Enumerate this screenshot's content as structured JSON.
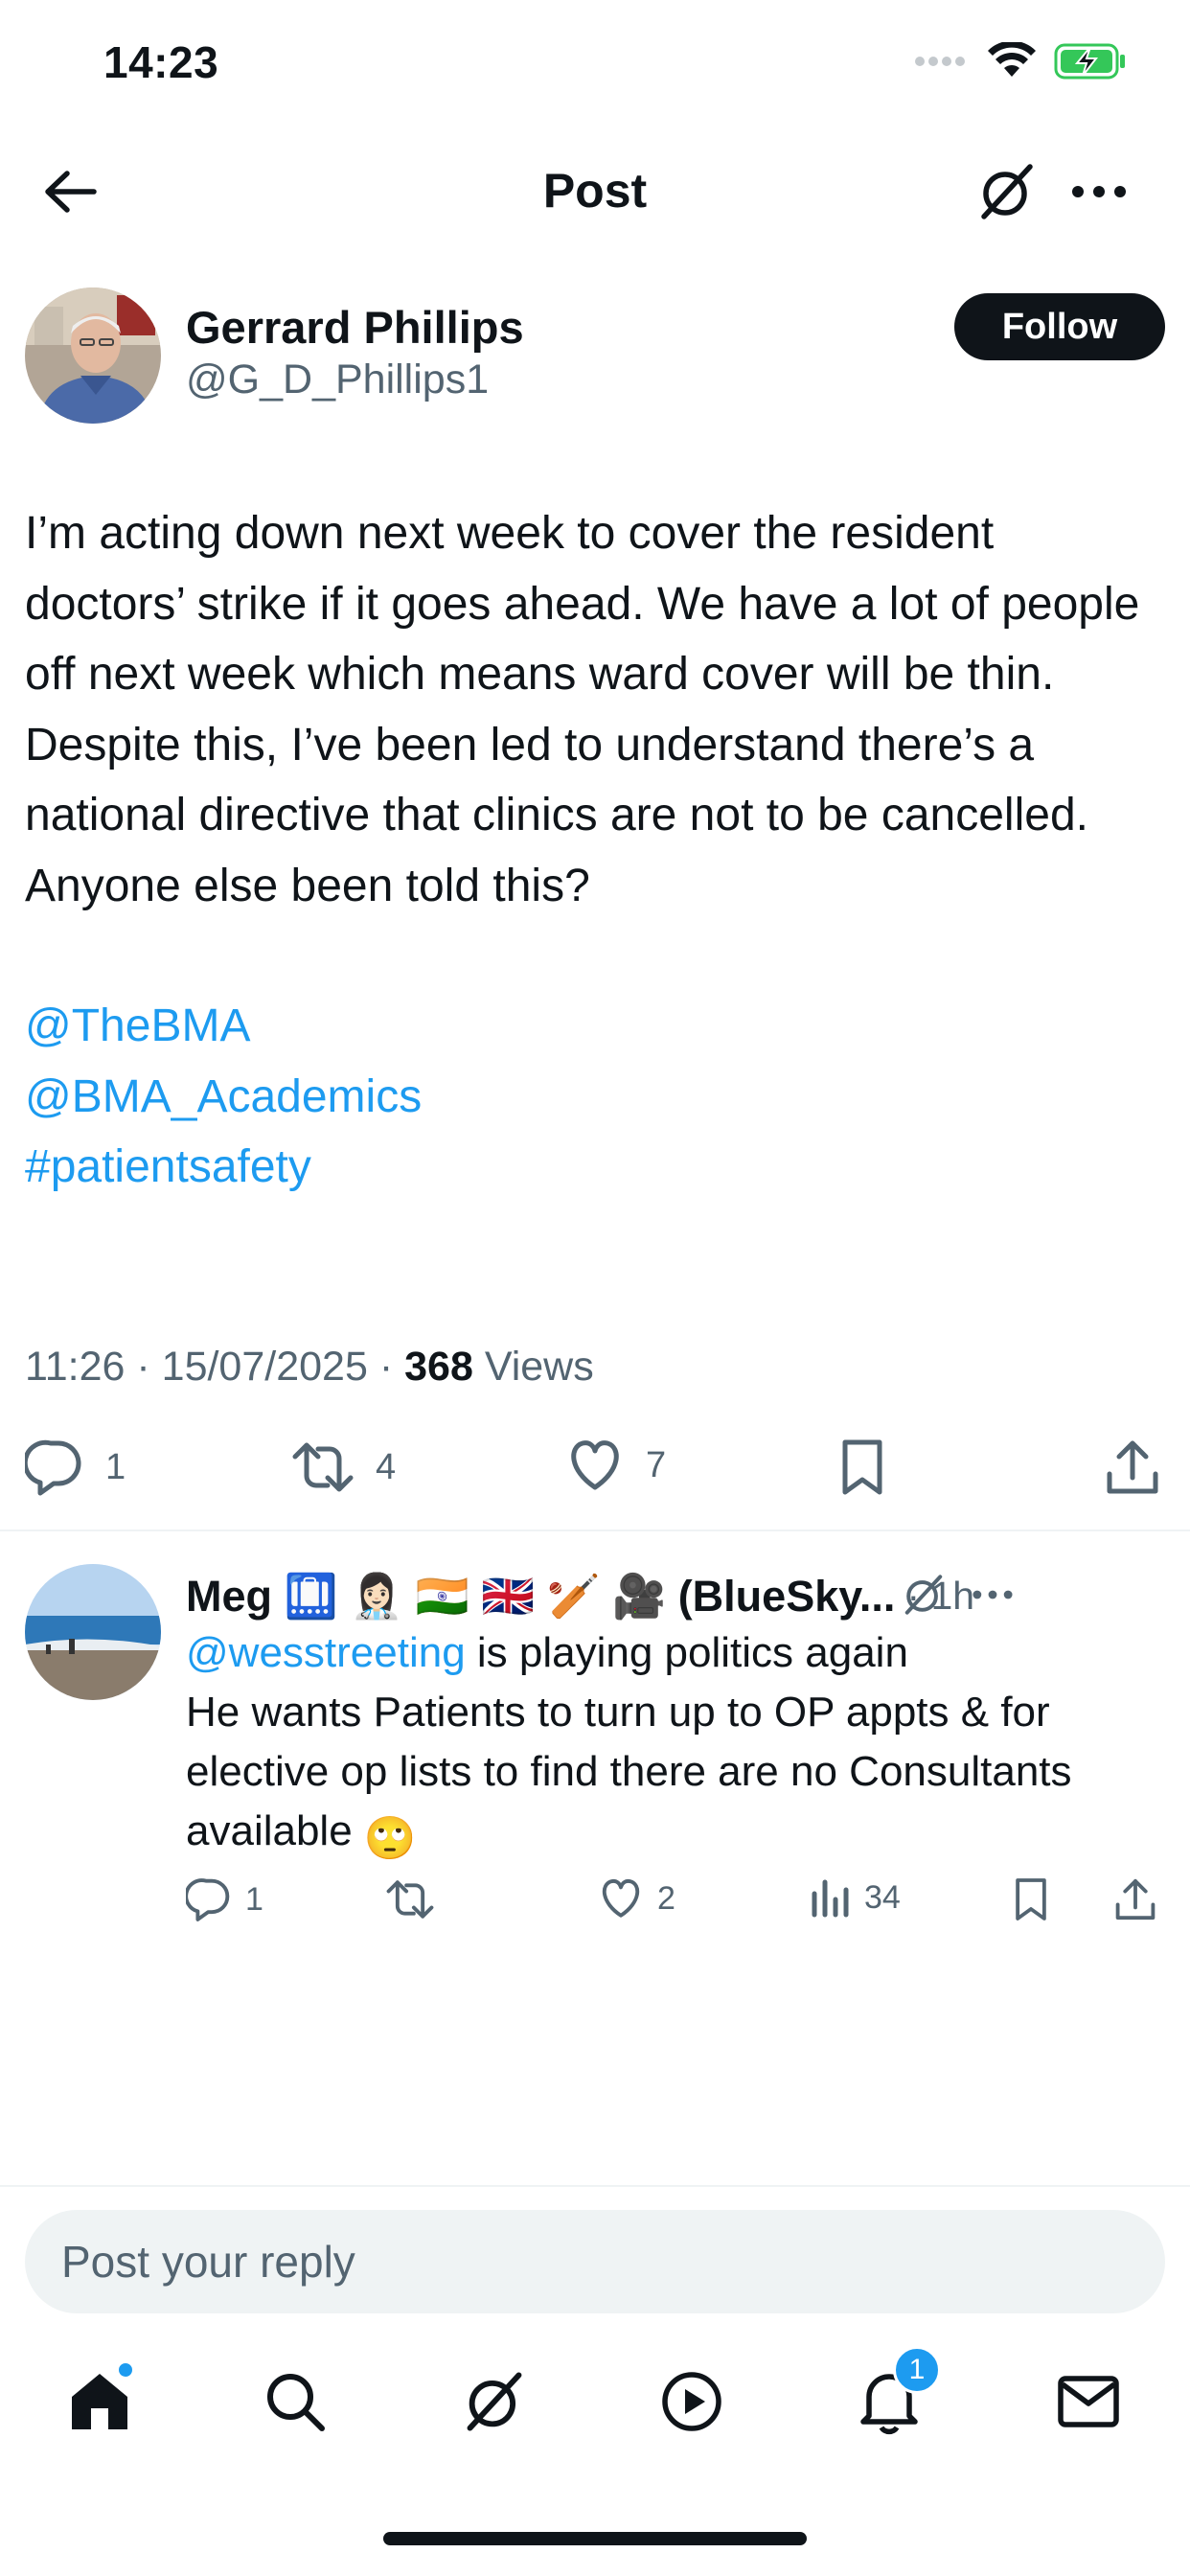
{
  "status_bar": {
    "time": "14:23",
    "signal_icon": "signal-dots-icon",
    "wifi_icon": "wifi-icon",
    "battery_icon": "battery-charging-icon",
    "battery_color": "#34c759"
  },
  "header": {
    "title": "Post",
    "back_icon": "back-arrow-icon",
    "grok_icon": "grok-icon",
    "more_icon": "more-icon"
  },
  "post": {
    "author": {
      "name": "Gerrard Phillips",
      "handle": "@G_D_Phillips1",
      "follow_label": "Follow"
    },
    "text": "I’m acting down next week to cover the resident doctors’ strike if it goes ahead. We have a lot of people off next week which means ward cover will be thin. Despite this, I’ve been led to understand there’s a national directive that clinics are not to be cancelled. Anyone else been told this?",
    "links": [
      "@TheBMA",
      "@BMA_Academics",
      "#patientsafety"
    ],
    "meta": {
      "time": "11:26",
      "date": "15/07/2025",
      "views": "368",
      "views_label": "Views"
    },
    "actions": {
      "replies": "1",
      "reposts": "4",
      "likes": "7"
    }
  },
  "reply": {
    "name": "Meg 🛄 👩🏻‍⚕️ 🇮🇳 🇬🇧 🏏 🎥 (BlueSky...",
    "time": "· 1h",
    "mention": "@wesstreeting",
    "text_after_mention": " is playing politics again\nHe wants Patients to turn up to OP appts & for elective op lists to find there are no Consultants available ",
    "emoji": "🙄",
    "actions": {
      "replies": "1",
      "reposts": "",
      "likes": "2",
      "views": "34"
    }
  },
  "compose": {
    "placeholder": "Post your reply"
  },
  "tabbar": {
    "notification_count": "1"
  },
  "colors": {
    "accent": "#1d9bf0",
    "text": "#0f1419",
    "secondary": "#536471",
    "divider": "#eff3f4"
  }
}
